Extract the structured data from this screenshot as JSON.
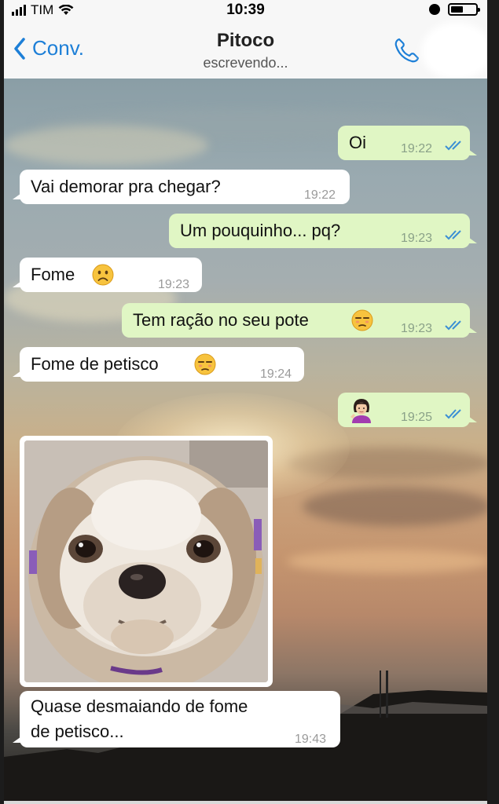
{
  "status_bar": {
    "carrier": "TIM",
    "time": "10:39"
  },
  "nav": {
    "back_label": "Conv.",
    "contact_name": "Pitoco",
    "contact_status": "escrevendo..."
  },
  "messages": [
    {
      "dir": "out",
      "text": "Oi",
      "time": "19:22",
      "read": true
    },
    {
      "dir": "in",
      "text": "Vai demorar pra chegar?",
      "time": "19:22"
    },
    {
      "dir": "out",
      "text": "Um pouquinho... pq?",
      "time": "19:23",
      "read": true
    },
    {
      "dir": "in",
      "text": "Fome",
      "emoji": "frowning-face",
      "time": "19:23"
    },
    {
      "dir": "out",
      "text": "Tem ração no seu pote",
      "emoji": "unamused-face",
      "time": "19:23",
      "read": true
    },
    {
      "dir": "in",
      "text": "Fome de petisco",
      "emoji": "unamused-face",
      "time": "19:24"
    },
    {
      "dir": "out",
      "emoji": "woman-shrugging",
      "time": "19:25",
      "read": true
    },
    {
      "dir": "in",
      "type": "photo",
      "subject": "shih-tzu-dog"
    },
    {
      "dir": "in",
      "text_line1": "Quase desmaiando de fome",
      "text_line2": "de petisco...",
      "time": "19:43"
    }
  ],
  "colors": {
    "accent": "#1d7fd7",
    "outgoing_bubble": "#e0f6c4",
    "incoming_bubble": "#ffffff",
    "read_ticks": "#3b8fd4"
  }
}
